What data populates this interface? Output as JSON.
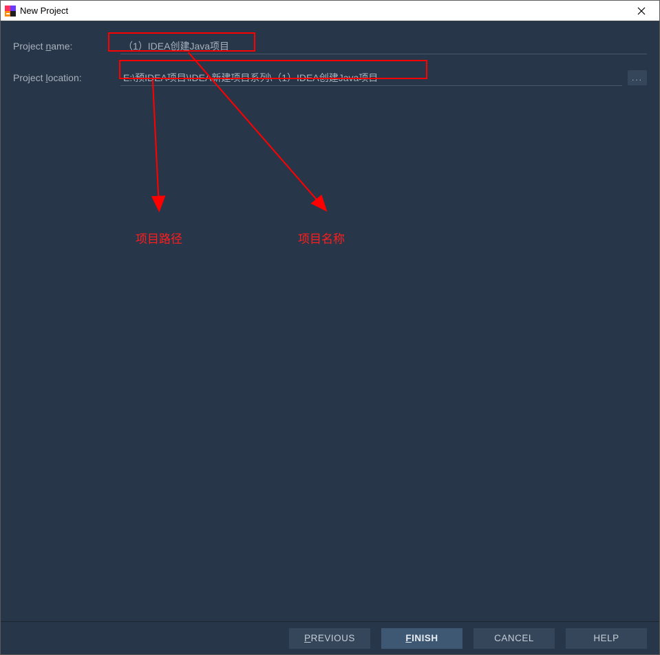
{
  "window": {
    "title": "New Project"
  },
  "form": {
    "name_label_pre": "Project ",
    "name_label_hot": "n",
    "name_label_post": "ame:",
    "name_value": "（1）IDEA创建Java项目",
    "location_label_pre": "Project ",
    "location_label_hot": "l",
    "location_label_post": "ocation:",
    "location_value": "E:\\预IDEA项目\\IDEA新建项目系列\\（1）IDEA创建Java项目",
    "browse_label": "..."
  },
  "annotations": {
    "path_label": "项目路径",
    "name_label": "项目名称"
  },
  "buttons": {
    "previous_hot": "P",
    "previous_rest": "REVIOUS",
    "finish_hot": "F",
    "finish_rest": "INISH",
    "cancel": "CANCEL",
    "help": "HELP"
  }
}
